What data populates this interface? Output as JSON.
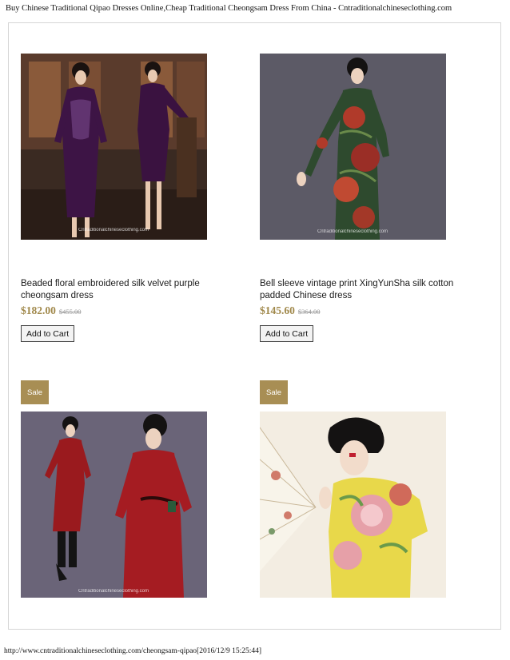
{
  "page": {
    "title": "Buy Chinese Traditional Qipao Dresses Online,Cheap Traditional Cheongsam Dress From China - Cntraditionalchineseclothing.com",
    "footer_url": "http://www.cntraditionalchineseclothing.com/cheongsam-qipao[2016/12/9 15:25:44]"
  },
  "watermark": "Cntraditionalchineseclothing.com",
  "products": [
    {
      "name": "Beaded floral embroidered silk velvet purple cheongsam dress",
      "price": "$182.00",
      "old_price": "$455.00",
      "button": "Add to Cart"
    },
    {
      "name": "Bell sleeve vintage print XingYunSha silk cotton padded Chinese dress",
      "price": "$145.60",
      "old_price": "$364.00",
      "button": "Add to Cart"
    },
    {
      "badge": "Sale"
    },
    {
      "badge": "Sale"
    }
  ],
  "colors": {
    "sale_badge": "#a88e54",
    "price": "#a0884a"
  }
}
